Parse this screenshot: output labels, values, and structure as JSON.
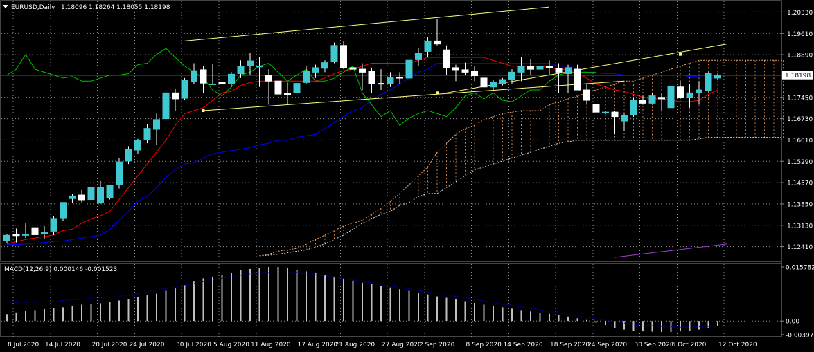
{
  "header": {
    "symbol_label": "EURUSD,Daily",
    "ohlc_label": "1.18096 1.18264 1.18055 1.18198"
  },
  "macd": {
    "label": "MACD(12,26,9) 0.000146 -0.001523",
    "axis_labels": [
      "0.015782",
      "0.00",
      "-0.003973"
    ]
  },
  "price_axis": {
    "labels": [
      "1.20330",
      "1.19610",
      "1.18890",
      "1.18198",
      "1.17450",
      "1.16730",
      "1.16010",
      "1.15290",
      "1.14570",
      "1.13850",
      "1.13130",
      "1.12410"
    ],
    "current": "1.18198"
  },
  "date_axis": {
    "labels": [
      "8 Jul 2020",
      "14 Jul 2020",
      "20 Jul 2020",
      "24 Jul 2020",
      "30 Jul 2020",
      "5 Aug 2020",
      "11 Aug 2020",
      "17 Aug 2020",
      "21 Aug 2020",
      "27 Aug 2020",
      "2 Sep 2020",
      "8 Sep 2020",
      "14 Sep 2020",
      "18 Sep 2020",
      "24 Sep 2020",
      "30 Sep 2020",
      "6 Oct 2020",
      "12 Oct 2020"
    ]
  },
  "colors": {
    "background": "#000000",
    "bull": "#40c8d0",
    "bear": "#ffffff",
    "tenkan": "#ff0000",
    "kijun": "#0000ff",
    "chikou": "#00c000",
    "cloud": "#f0a060",
    "trendline": "#ffff80",
    "macd_hist": "#c0c0c0",
    "macd_signal": "#0000c0",
    "grid": "#909090"
  },
  "chart_data": {
    "type": "candlestick",
    "title": "EURUSD,Daily",
    "ylim": [
      1.1205,
      1.2055
    ],
    "candles": [
      {
        "o": 1.1261,
        "h": 1.1282,
        "l": 1.1253,
        "c": 1.1279
      },
      {
        "o": 1.1283,
        "h": 1.1302,
        "l": 1.1255,
        "c": 1.1278
      },
      {
        "o": 1.1279,
        "h": 1.132,
        "l": 1.127,
        "c": 1.1282
      },
      {
        "o": 1.1305,
        "h": 1.133,
        "l": 1.127,
        "c": 1.1281
      },
      {
        "o": 1.1284,
        "h": 1.131,
        "l": 1.1268,
        "c": 1.1288
      },
      {
        "o": 1.1293,
        "h": 1.1344,
        "l": 1.128,
        "c": 1.1336
      },
      {
        "o": 1.1338,
        "h": 1.1382,
        "l": 1.1328,
        "c": 1.139
      },
      {
        "o": 1.1403,
        "h": 1.1418,
        "l": 1.1387,
        "c": 1.1412
      },
      {
        "o": 1.1415,
        "h": 1.1432,
        "l": 1.139,
        "c": 1.1399
      },
      {
        "o": 1.14,
        "h": 1.1452,
        "l": 1.139,
        "c": 1.1441
      },
      {
        "o": 1.139,
        "h": 1.1463,
        "l": 1.1385,
        "c": 1.1441
      },
      {
        "o": 1.1405,
        "h": 1.145,
        "l": 1.14,
        "c": 1.1447
      },
      {
        "o": 1.145,
        "h": 1.154,
        "l": 1.1437,
        "c": 1.1527
      },
      {
        "o": 1.153,
        "h": 1.158,
        "l": 1.152,
        "c": 1.157
      },
      {
        "o": 1.1567,
        "h": 1.1605,
        "l": 1.1553,
        "c": 1.16
      },
      {
        "o": 1.1602,
        "h": 1.1655,
        "l": 1.159,
        "c": 1.164
      },
      {
        "o": 1.1637,
        "h": 1.169,
        "l": 1.1585,
        "c": 1.167
      },
      {
        "o": 1.1673,
        "h": 1.178,
        "l": 1.167,
        "c": 1.176
      },
      {
        "o": 1.176,
        "h": 1.1775,
        "l": 1.17,
        "c": 1.174
      },
      {
        "o": 1.1742,
        "h": 1.181,
        "l": 1.1735,
        "c": 1.1802
      },
      {
        "o": 1.1799,
        "h": 1.186,
        "l": 1.179,
        "c": 1.1835
      },
      {
        "o": 1.1838,
        "h": 1.185,
        "l": 1.176,
        "c": 1.1793
      },
      {
        "o": 1.179,
        "h": 1.1858,
        "l": 1.179,
        "c": 1.179
      },
      {
        "o": 1.1795,
        "h": 1.1835,
        "l": 1.169,
        "c": 1.1792
      },
      {
        "o": 1.1792,
        "h": 1.183,
        "l": 1.178,
        "c": 1.1823
      },
      {
        "o": 1.1825,
        "h": 1.187,
        "l": 1.181,
        "c": 1.185
      },
      {
        "o": 1.1852,
        "h": 1.1895,
        "l": 1.182,
        "c": 1.1868
      },
      {
        "o": 1.185,
        "h": 1.188,
        "l": 1.178,
        "c": 1.185
      },
      {
        "o": 1.182,
        "h": 1.184,
        "l": 1.172,
        "c": 1.18
      },
      {
        "o": 1.18,
        "h": 1.181,
        "l": 1.1745,
        "c": 1.1756
      },
      {
        "o": 1.1758,
        "h": 1.1795,
        "l": 1.172,
        "c": 1.1753
      },
      {
        "o": 1.176,
        "h": 1.18,
        "l": 1.175,
        "c": 1.1792
      },
      {
        "o": 1.1795,
        "h": 1.185,
        "l": 1.179,
        "c": 1.1832
      },
      {
        "o": 1.183,
        "h": 1.1855,
        "l": 1.181,
        "c": 1.1845
      },
      {
        "o": 1.1843,
        "h": 1.187,
        "l": 1.183,
        "c": 1.1862
      },
      {
        "o": 1.1865,
        "h": 1.193,
        "l": 1.186,
        "c": 1.192
      },
      {
        "o": 1.192,
        "h": 1.1935,
        "l": 1.184,
        "c": 1.1845
      },
      {
        "o": 1.1845,
        "h": 1.185,
        "l": 1.182,
        "c": 1.184
      },
      {
        "o": 1.184,
        "h": 1.186,
        "l": 1.177,
        "c": 1.183
      },
      {
        "o": 1.1832,
        "h": 1.1845,
        "l": 1.176,
        "c": 1.179
      },
      {
        "o": 1.1792,
        "h": 1.184,
        "l": 1.177,
        "c": 1.179
      },
      {
        "o": 1.1792,
        "h": 1.183,
        "l": 1.178,
        "c": 1.1812
      },
      {
        "o": 1.1812,
        "h": 1.183,
        "l": 1.179,
        "c": 1.181
      },
      {
        "o": 1.181,
        "h": 1.189,
        "l": 1.18,
        "c": 1.187
      },
      {
        "o": 1.1872,
        "h": 1.191,
        "l": 1.185,
        "c": 1.1895
      },
      {
        "o": 1.19,
        "h": 1.195,
        "l": 1.188,
        "c": 1.1935
      },
      {
        "o": 1.1935,
        "h": 1.201,
        "l": 1.192,
        "c": 1.1925
      },
      {
        "o": 1.1905,
        "h": 1.192,
        "l": 1.182,
        "c": 1.1845
      },
      {
        "o": 1.1845,
        "h": 1.1855,
        "l": 1.18,
        "c": 1.1838
      },
      {
        "o": 1.1838,
        "h": 1.1862,
        "l": 1.182,
        "c": 1.183
      },
      {
        "o": 1.1832,
        "h": 1.185,
        "l": 1.18,
        "c": 1.1818
      },
      {
        "o": 1.181,
        "h": 1.1835,
        "l": 1.1765,
        "c": 1.178
      },
      {
        "o": 1.178,
        "h": 1.1805,
        "l": 1.177,
        "c": 1.1795
      },
      {
        "o": 1.1792,
        "h": 1.181,
        "l": 1.1785,
        "c": 1.1805
      },
      {
        "o": 1.1805,
        "h": 1.184,
        "l": 1.179,
        "c": 1.183
      },
      {
        "o": 1.183,
        "h": 1.188,
        "l": 1.18,
        "c": 1.185
      },
      {
        "o": 1.185,
        "h": 1.1875,
        "l": 1.182,
        "c": 1.184
      },
      {
        "o": 1.184,
        "h": 1.1885,
        "l": 1.182,
        "c": 1.185
      },
      {
        "o": 1.185,
        "h": 1.187,
        "l": 1.182,
        "c": 1.1845
      },
      {
        "o": 1.1843,
        "h": 1.186,
        "l": 1.176,
        "c": 1.183
      },
      {
        "o": 1.1825,
        "h": 1.1855,
        "l": 1.176,
        "c": 1.1845
      },
      {
        "o": 1.184,
        "h": 1.1855,
        "l": 1.178,
        "c": 1.177
      },
      {
        "o": 1.177,
        "h": 1.179,
        "l": 1.172,
        "c": 1.1735
      },
      {
        "o": 1.172,
        "h": 1.173,
        "l": 1.168,
        "c": 1.1695
      },
      {
        "o": 1.1692,
        "h": 1.17,
        "l": 1.1688,
        "c": 1.1695
      },
      {
        "o": 1.1695,
        "h": 1.17,
        "l": 1.162,
        "c": 1.168
      },
      {
        "o": 1.1665,
        "h": 1.169,
        "l": 1.163,
        "c": 1.1684
      },
      {
        "o": 1.1685,
        "h": 1.1745,
        "l": 1.168,
        "c": 1.1735
      },
      {
        "o": 1.1735,
        "h": 1.175,
        "l": 1.172,
        "c": 1.1725
      },
      {
        "o": 1.1725,
        "h": 1.176,
        "l": 1.172,
        "c": 1.175
      },
      {
        "o": 1.1745,
        "h": 1.176,
        "l": 1.17,
        "c": 1.174
      },
      {
        "o": 1.171,
        "h": 1.179,
        "l": 1.17,
        "c": 1.1783
      },
      {
        "o": 1.178,
        "h": 1.18,
        "l": 1.174,
        "c": 1.1745
      },
      {
        "o": 1.1745,
        "h": 1.179,
        "l": 1.171,
        "c": 1.176
      },
      {
        "o": 1.176,
        "h": 1.18,
        "l": 1.172,
        "c": 1.177
      },
      {
        "o": 1.1768,
        "h": 1.183,
        "l": 1.1765,
        "c": 1.1825
      },
      {
        "o": 1.181,
        "h": 1.1826,
        "l": 1.1805,
        "c": 1.182
      }
    ],
    "tenkan": [
      1.125,
      1.1258,
      1.1265,
      1.127,
      1.1275,
      1.128,
      1.1295,
      1.13,
      1.132,
      1.1335,
      1.1345,
      1.136,
      1.14,
      1.144,
      1.148,
      1.152,
      1.156,
      1.16,
      1.165,
      1.169,
      1.17,
      1.171,
      1.1735,
      1.176,
      1.1765,
      1.1785,
      1.1795,
      1.18,
      1.18,
      1.18,
      1.18,
      1.18,
      1.18,
      1.18,
      1.181,
      1.1825,
      1.1835,
      1.184,
      1.185,
      1.186,
      1.186,
      1.186,
      1.186,
      1.186,
      1.187,
      1.188,
      1.188,
      1.188,
      1.188,
      1.188,
      1.188,
      1.188,
      1.187,
      1.186,
      1.185,
      1.185,
      1.185,
      1.185,
      1.1845,
      1.184,
      1.184,
      1.183,
      1.181,
      1.179,
      1.178,
      1.177,
      1.1765,
      1.1755,
      1.1745,
      1.174,
      1.174,
      1.1735,
      1.173,
      1.173,
      1.1735,
      1.1755,
      1.177
    ],
    "kijun": [
      1.1248,
      1.1248,
      1.125,
      1.1252,
      1.1255,
      1.1258,
      1.126,
      1.1265,
      1.127,
      1.1275,
      1.128,
      1.13,
      1.133,
      1.136,
      1.1395,
      1.141,
      1.144,
      1.1475,
      1.15,
      1.152,
      1.1525,
      1.154,
      1.1555,
      1.156,
      1.1565,
      1.157,
      1.1575,
      1.1585,
      1.159,
      1.16,
      1.16,
      1.161,
      1.1615,
      1.162,
      1.164,
      1.166,
      1.168,
      1.17,
      1.171,
      1.1735,
      1.1755,
      1.177,
      1.179,
      1.181,
      1.183,
      1.184,
      1.186,
      1.186,
      1.186,
      1.186,
      1.186,
      1.186,
      1.186,
      1.186,
      1.186,
      1.186,
      1.186,
      1.186,
      1.186,
      1.185,
      1.185,
      1.184,
      1.183,
      1.1828,
      1.1825,
      1.1825,
      1.182,
      1.182,
      1.182,
      1.182,
      1.182,
      1.182,
      1.182,
      1.1815,
      1.1815,
      1.181,
      1.181
    ],
    "chikou": [
      1.182,
      1.184,
      1.189,
      1.184,
      1.183,
      1.182,
      1.181,
      1.1815,
      1.18,
      1.18,
      1.181,
      1.182,
      1.182,
      1.1825,
      1.1855,
      1.186,
      1.189,
      1.191,
      1.188,
      1.185,
      1.183,
      1.181,
      1.177,
      1.175,
      1.178,
      1.182,
      1.183,
      1.185,
      1.186,
      1.183,
      1.18,
      1.182,
      1.184,
      1.18,
      1.18,
      1.181,
      1.183,
      1.185,
      1.176,
      1.172,
      1.168,
      1.17,
      1.165,
      1.1675,
      1.169,
      1.17,
      1.169,
      1.168,
      1.171,
      1.175,
      1.176,
      1.174,
      1.176,
      1.1735,
      1.173,
      1.175,
      1.177,
      1.177,
      1.18,
      1.182,
      1.183,
      1.183,
      1.183,
      1.183
    ],
    "cloud": {
      "start_index": 27,
      "span_a": [
        1.121,
        1.1215,
        1.1225,
        1.123,
        1.1235,
        1.125,
        1.1265,
        1.128,
        1.1295,
        1.131,
        1.132,
        1.133,
        1.135,
        1.137,
        1.1395,
        1.142,
        1.145,
        1.148,
        1.151,
        1.156,
        1.159,
        1.162,
        1.164,
        1.165,
        1.167,
        1.168,
        1.169,
        1.1695,
        1.17,
        1.17,
        1.17,
        1.172,
        1.173,
        1.174,
        1.175,
        1.176,
        1.177,
        1.178,
        1.179,
        1.18,
        1.18,
        1.181,
        1.182,
        1.183,
        1.184,
        1.185,
        1.186,
        1.187,
        1.187,
        1.187,
        1.187,
        1.187,
        1.187,
        1.187,
        1.187,
        1.187,
        1.187
      ],
      "span_b": [
        1.121,
        1.1212,
        1.1215,
        1.122,
        1.1225,
        1.123,
        1.124,
        1.125,
        1.1265,
        1.128,
        1.13,
        1.132,
        1.1335,
        1.135,
        1.136,
        1.138,
        1.139,
        1.141,
        1.142,
        1.142,
        1.144,
        1.146,
        1.148,
        1.15,
        1.151,
        1.152,
        1.153,
        1.154,
        1.155,
        1.156,
        1.157,
        1.158,
        1.159,
        1.1595,
        1.16,
        1.16,
        1.16,
        1.16,
        1.16,
        1.16,
        1.16,
        1.16,
        1.16,
        1.16,
        1.16,
        1.16,
        1.16,
        1.1605,
        1.161,
        1.161,
        1.161,
        1.161,
        1.161,
        1.161,
        1.161,
        1.161,
        1.161
      ]
    },
    "macd_hist": [
      0.002,
      0.0025,
      0.003,
      0.0032,
      0.0035,
      0.0037,
      0.004,
      0.0045,
      0.0048,
      0.005,
      0.0052,
      0.0055,
      0.006,
      0.0065,
      0.007,
      0.0075,
      0.008,
      0.0088,
      0.0095,
      0.0105,
      0.0115,
      0.0125,
      0.013,
      0.0135,
      0.014,
      0.0148,
      0.0152,
      0.0155,
      0.0158,
      0.0158,
      0.0155,
      0.015,
      0.0145,
      0.014,
      0.0135,
      0.013,
      0.0125,
      0.0118,
      0.0112,
      0.0108,
      0.0103,
      0.0098,
      0.0093,
      0.0088,
      0.0083,
      0.0078,
      0.0072,
      0.0068,
      0.0063,
      0.0058,
      0.0053,
      0.0048,
      0.0044,
      0.004,
      0.0036,
      0.0032,
      0.0028,
      0.0024,
      0.0021,
      0.0017,
      0.0013,
      0.0008,
      0.0003,
      -0.0005,
      -0.0012,
      -0.002,
      -0.0025,
      -0.0028,
      -0.003,
      -0.0031,
      -0.0032,
      -0.0032,
      -0.003,
      -0.0028,
      -0.0025,
      -0.002,
      -0.0015
    ],
    "macd_signal": [
      0.0055,
      0.0055,
      0.0055,
      0.0055,
      0.0056,
      0.0058,
      0.006,
      0.0062,
      0.0064,
      0.0066,
      0.0068,
      0.007,
      0.0072,
      0.0075,
      0.008,
      0.0085,
      0.009,
      0.0095,
      0.01,
      0.0105,
      0.011,
      0.0115,
      0.012,
      0.0125,
      0.013,
      0.0134,
      0.0138,
      0.014,
      0.0142,
      0.0143,
      0.0143,
      0.0141,
      0.0138,
      0.0135,
      0.0132,
      0.0128,
      0.0124,
      0.012,
      0.0116,
      0.0111,
      0.0107,
      0.0102,
      0.0098,
      0.0094,
      0.0089,
      0.0085,
      0.008,
      0.0076,
      0.0072,
      0.0068,
      0.0063,
      0.0059,
      0.0055,
      0.005,
      0.0046,
      0.0041,
      0.0037,
      0.0033,
      0.0028,
      0.0024,
      0.0019,
      0.0015,
      0.0011,
      0.0006,
      0.0002,
      -0.0002,
      -0.0006,
      -0.0009,
      -0.0012,
      -0.0014,
      -0.0016,
      -0.0017,
      -0.0018,
      -0.0018,
      -0.0017,
      -0.0016,
      -0.0015
    ],
    "macd_ylim": [
      -0.004,
      0.016
    ],
    "trendlines": [
      {
        "name": "upper-channel",
        "from": {
          "i": 19,
          "p": 1.1935
        },
        "to": {
          "i": 58,
          "p": 1.205
        }
      },
      {
        "name": "lower-channel",
        "from": {
          "i": 21,
          "p": 1.17
        },
        "to": {
          "i": 66,
          "p": 1.18
        }
      },
      {
        "name": "middle-channel",
        "from": {
          "i": 47,
          "p": 1.176
        },
        "to": {
          "i": 77,
          "p": 1.1925
        }
      }
    ],
    "guide_line": {
      "name": "purple-line",
      "from": {
        "i": 65,
        "p": 1.1205
      },
      "to": {
        "i": 77,
        "p": 1.125
      }
    }
  }
}
